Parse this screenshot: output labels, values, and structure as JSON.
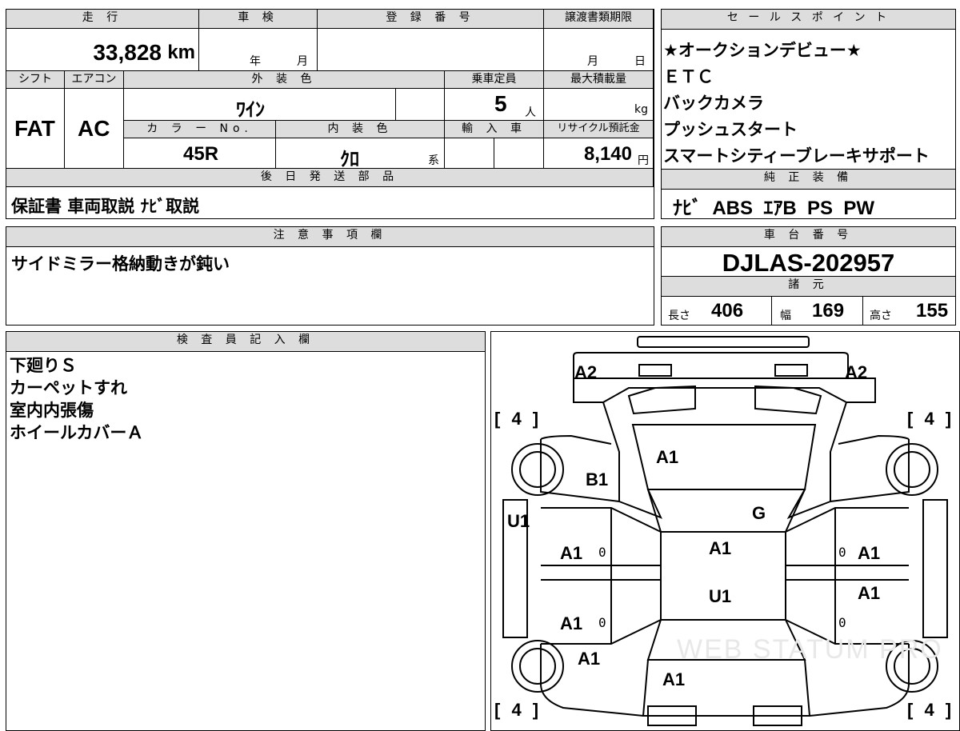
{
  "mileage": {
    "header": "走 行",
    "value": "33,828",
    "unit": "km"
  },
  "inspection": {
    "header": "車 検",
    "year_label": "年",
    "month_label": "月"
  },
  "registration": {
    "header": "登 録 番 号"
  },
  "transfer_deadline": {
    "header": "譲渡書類期限",
    "month_label": "月",
    "day_label": "日"
  },
  "shift": {
    "header": "シフト",
    "value": "FAT"
  },
  "aircon": {
    "header": "エアコン",
    "value": "AC"
  },
  "exterior_color": {
    "header": "外 装 色",
    "value": "ﾜｲﾝ"
  },
  "capacity": {
    "header": "乗車定員",
    "value": "5",
    "unit": "人"
  },
  "max_load": {
    "header": "最大積載量",
    "unit": "kg"
  },
  "color_no": {
    "header": "カ ラ ー No.",
    "value": "45R"
  },
  "interior_color": {
    "header": "内 装 色",
    "value": "ｸﾛ",
    "suffix": "系"
  },
  "import": {
    "header": "輸 入 車"
  },
  "recycle_fee": {
    "header": "リサイクル預託金",
    "value": "8,140",
    "unit": "円"
  },
  "later_shipment": {
    "header": "後 日 発 送 部 品",
    "value": "保証書 車両取説 ﾅﾋﾞ取説"
  },
  "sales_points": {
    "header": "セ ー ル ス ポ イ ン ト",
    "items": [
      "★オークションデビュー★",
      "ＥＴＣ",
      "バックカメラ",
      "プッシュスタート",
      "スマートシティーブレーキサポート"
    ]
  },
  "standard_equipment": {
    "header": "純 正 装 備",
    "value": "ﾅﾋﾞ  ABS  ｴｱB  PS  PW"
  },
  "notes": {
    "header": "注 意 事 項 欄",
    "value": "サイドミラー格納動きが鈍い"
  },
  "chassis": {
    "header": "車 台 番 号",
    "value": "DJLAS-202957"
  },
  "specs": {
    "header": "諸 元",
    "length_label": "長さ",
    "length": "406",
    "width_label": "幅",
    "width": "169",
    "height_label": "高さ",
    "height": "155"
  },
  "inspector": {
    "header": "検 査 員 記 入 欄",
    "lines": [
      "下廻りＳ",
      "カーペットすれ",
      "室内内張傷",
      "ホイールカバーＡ"
    ]
  },
  "diagram": {
    "marks": {
      "front_left_corner": "A2",
      "front_right_corner": "A2",
      "hood": "A1",
      "front_left_fender": "B1",
      "windshield_area": "G",
      "left_pillar": "U1",
      "roof": "A1",
      "roof_rear": "U1",
      "left_front_door": "A1",
      "left_rear_door": "A1",
      "left_rear_quarter": "A1",
      "right_front_door": "A1",
      "right_rear_door": "A1",
      "trunk": "A1"
    },
    "tire_labels": {
      "fl": "[ 4 ]",
      "fr": "[ 4 ]",
      "rl": "[ 4 ]",
      "rr": "[ 4 ]"
    },
    "zero": "0",
    "watermark": "WEB STATUM PRO"
  }
}
